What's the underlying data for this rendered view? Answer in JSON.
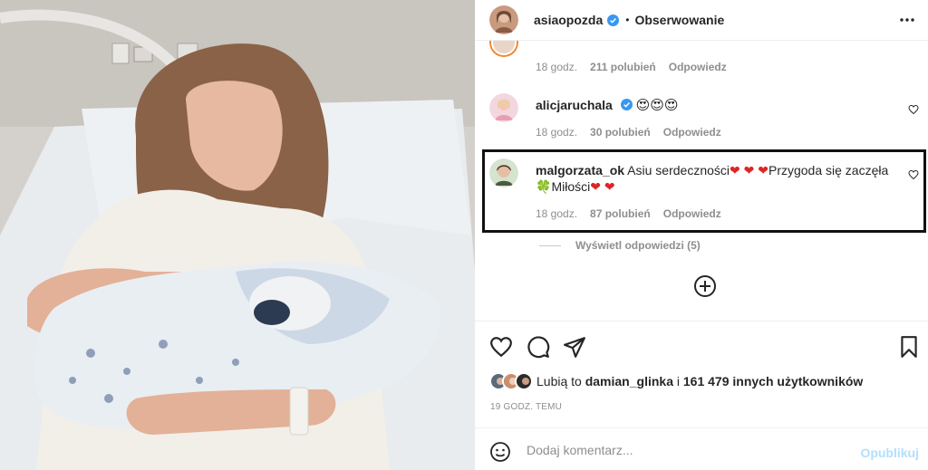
{
  "post": {
    "author": "asiaopozda",
    "separator": "•",
    "follow_state": "Obserwowanie",
    "more_icon": "more-horizontal-icon"
  },
  "comments": [
    {
      "username": "",
      "text": "",
      "time": "18 godz.",
      "likes": "211 polubień",
      "reply": "Odpowiedz"
    },
    {
      "username": "alicjaruchala",
      "verified": true,
      "text": "😍😍😍",
      "time": "18 godz.",
      "likes": "30 polubień",
      "reply": "Odpowiedz"
    },
    {
      "username": "malgorzata_ok",
      "text_part1": "Asiu serdeczności",
      "hearts1": "❤ ❤ ❤",
      "text_part2": "Przygoda się zaczęła",
      "clover": "🍀",
      "text_part3": "Miłości",
      "hearts2": "❤ ❤",
      "time": "18 godz.",
      "likes": "87 polubień",
      "reply": "Odpowiedz"
    }
  ],
  "view_replies": "Wyświetl odpowiedzi (5)",
  "likes_summary": {
    "prefix": "Lubią to",
    "user": "damian_glinka",
    "middle": "i",
    "count": "161 479 innych użytkowników"
  },
  "time_ago": "19 GODZ. TEMU",
  "add_comment": {
    "placeholder": "Dodaj komentarz...",
    "publish": "Opublikuj"
  },
  "colors": {
    "verified": "#3897f0",
    "publish_disabled": "#b2dffc",
    "highlight_border": "#111111",
    "meta_text": "#8e8e8e"
  }
}
